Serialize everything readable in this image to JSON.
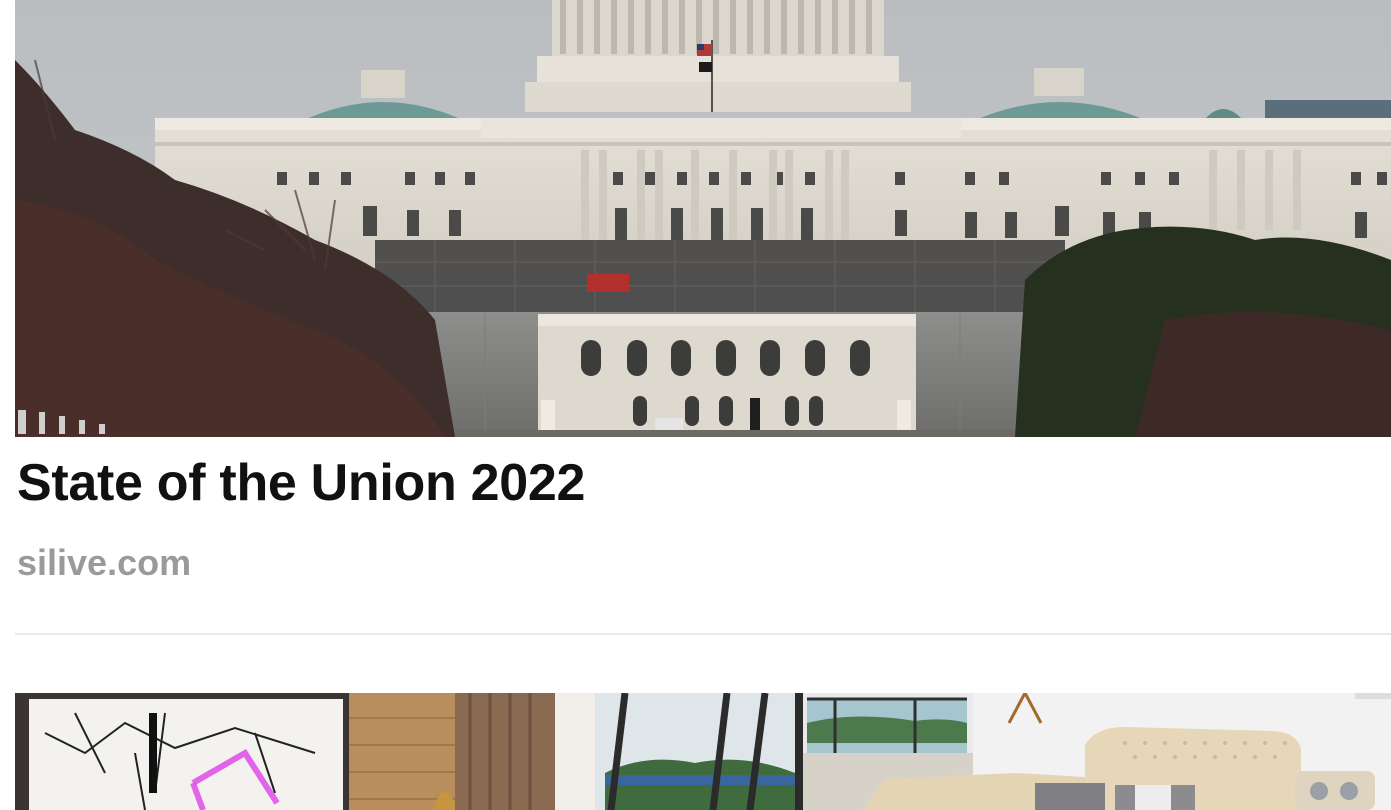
{
  "article": {
    "title": "State of the Union 2022",
    "source": "silive.com",
    "image_subject": "us-capitol-building"
  },
  "next_article": {
    "image_subject": "modern-living-room"
  }
}
